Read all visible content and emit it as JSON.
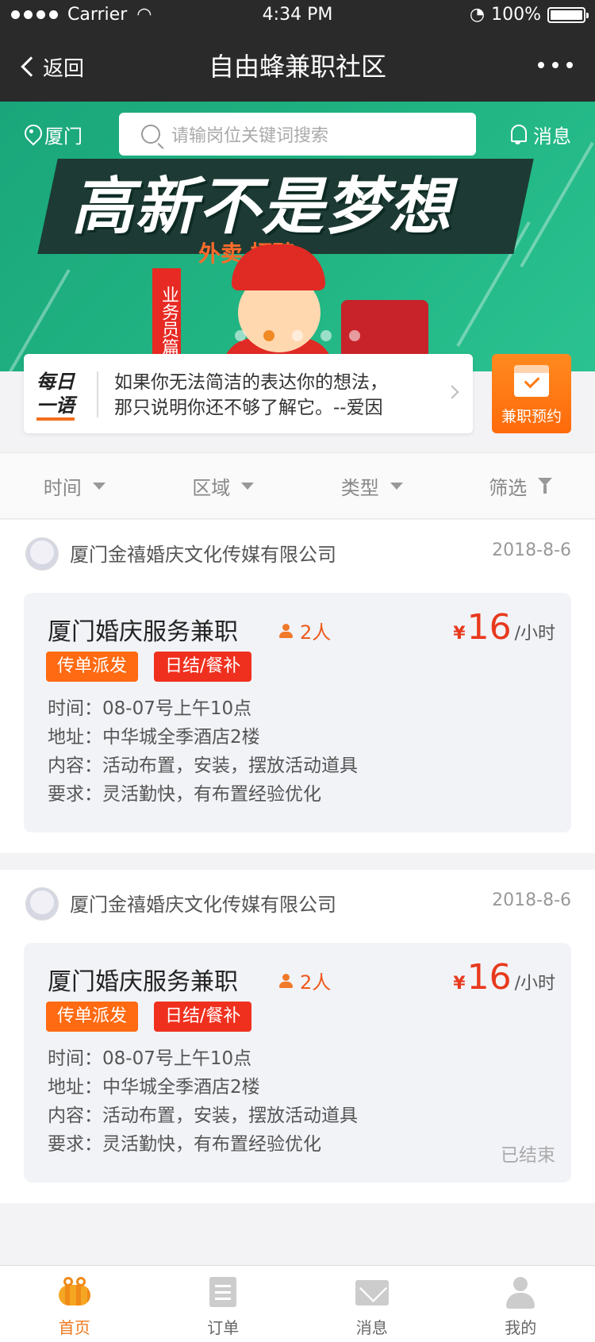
{
  "status_bar": {
    "carrier": "Carrier",
    "time": "4:34 PM",
    "battery": "100%"
  },
  "nav": {
    "back_label": "返回",
    "title": "自由蜂兼职社区"
  },
  "banner": {
    "location": "厦门",
    "search_placeholder": "请输岗位关键词搜索",
    "messages_label": "消息",
    "headline": "高新不是梦想",
    "subline": "外卖   招聘",
    "side_label": "业务员篇",
    "slide_count": 5,
    "active_slide": 2
  },
  "quote": {
    "logo_line1": "每日",
    "logo_line2": "一语",
    "text_line1": "如果你无法简洁的表达你的想法，",
    "text_line2": "那只说明你还不够了解它。--爱因"
  },
  "booking": {
    "label": "兼职预约"
  },
  "filters": [
    "时间",
    "区域",
    "类型",
    "筛选"
  ],
  "jobs": [
    {
      "company": "厦门金禧婚庆文化传媒有限公司",
      "date": "2018-8-6",
      "title": "厦门婚庆服务兼职",
      "headcount": "2人",
      "currency": "¥",
      "price": "16",
      "unit": "/小时",
      "tags": [
        "传单派发",
        "日结/餐补"
      ],
      "time": "时间：08-07号上午10点",
      "address": "地址：中华城全季酒店2楼",
      "content": "内容：活动布置，安装，摆放活动道具",
      "requirement": "要求：灵活勤快，有布置经验优化",
      "status": ""
    },
    {
      "company": "厦门金禧婚庆文化传媒有限公司",
      "date": "2018-8-6",
      "title": "厦门婚庆服务兼职",
      "headcount": "2人",
      "currency": "¥",
      "price": "16",
      "unit": "/小时",
      "tags": [
        "传单派发",
        "日结/餐补"
      ],
      "time": "时间：08-07号上午10点",
      "address": "地址：中华城全季酒店2楼",
      "content": "内容：活动布置，安装，摆放活动道具",
      "requirement": "要求：灵活勤快，有布置经验优化",
      "status": "已结束"
    }
  ],
  "tabbar": [
    {
      "label": "首页",
      "icon": "bee-icon",
      "active": true
    },
    {
      "label": "订单",
      "icon": "order-icon",
      "active": false
    },
    {
      "label": "消息",
      "icon": "mail-icon",
      "active": false
    },
    {
      "label": "我的",
      "icon": "user-icon",
      "active": false
    }
  ],
  "colors": {
    "accent": "#f0781e",
    "banner_green": "#21b583",
    "price_red": "#e8391d",
    "tag_orange": "#ff6a12",
    "tag_red": "#f0301e"
  }
}
